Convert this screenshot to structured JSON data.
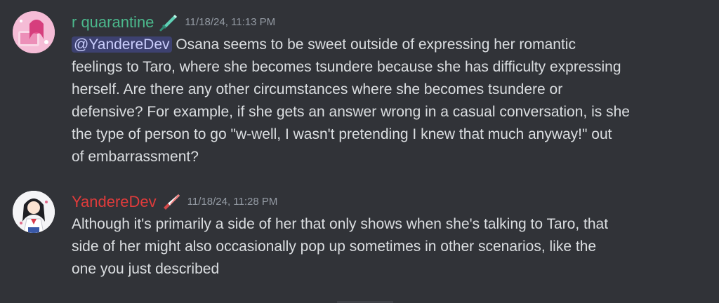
{
  "messages": [
    {
      "username": "r quarantine",
      "username_color": "#4bb88c",
      "badge_icon": "sword-icon",
      "badge_color": "#5fd1b6",
      "timestamp": "11/18/24, 11:13 PM",
      "mention": "@YandereDev",
      "text": " Osana seems to be sweet outside of expressing her romantic\nfeelings to Taro, where she becomes tsundere because she has difficulty expressing\nherself. Are there any other circumstances where she becomes tsundere or\ndefensive? For example, if she gets an answer wrong in a casual conversation, is she\nthe type of person to go \"w-well, I wasn't pretending I knew that much anyway!\" out\nof embarrassment?"
    },
    {
      "username": "YandereDev",
      "username_color": "#e03b3b",
      "badge_icon": "knife-icon",
      "badge_color": "#f07c7c",
      "timestamp": "11/18/24, 11:28 PM",
      "text": "Although it's primarily a side of her that only shows when she's talking to Taro, that\nside of her might also occasionally pop up sometimes in other scenarios, like the\none you just described"
    }
  ]
}
